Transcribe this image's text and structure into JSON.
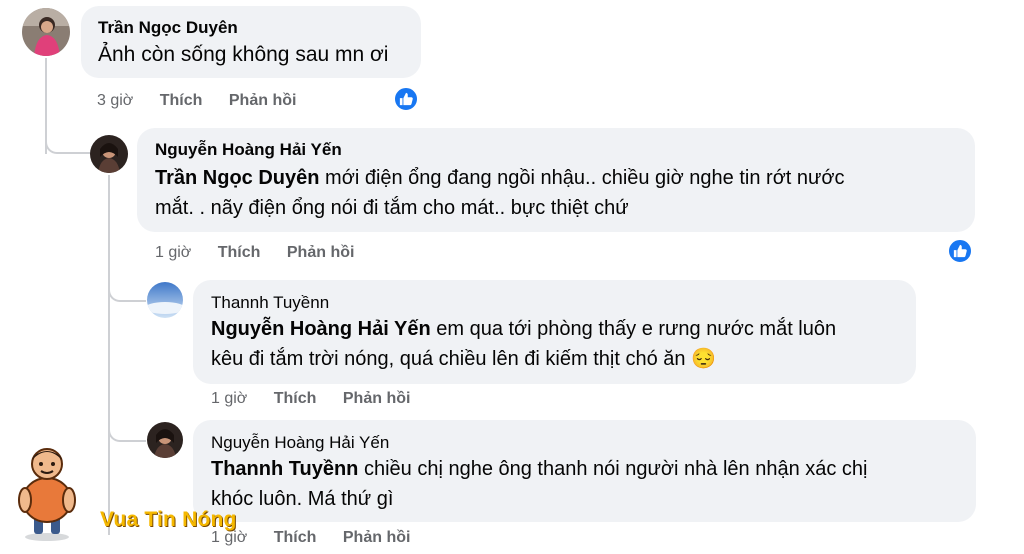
{
  "comments": [
    {
      "author": "Trần Ngọc Duyên",
      "tag": "",
      "text": "Ảnh còn sống không sau mn ơi",
      "time": "3 giờ",
      "like": "Thích",
      "reply": "Phản hồi",
      "liked_icon": "thumbs-up-icon"
    },
    {
      "author": "Nguyễn Hoàng Hải Yến",
      "tag": "Trần Ngọc Duyên",
      "text_line1": " mới điện ổng đang ngồi nhậu.. chiều giờ nghe tin rớt nước",
      "text_line2": "mắt. . nãy điện ổng nói đi tắm cho mát.. bực thiệt chứ",
      "time": "1 giờ",
      "like": "Thích",
      "reply": "Phản hồi",
      "liked_icon": "thumbs-up-icon"
    },
    {
      "author": "Thannh Tuyềnn",
      "tag": "Nguyễn Hoàng Hải Yến",
      "text_line1": " em qua tới phòng thấy e rưng nước mắt luôn",
      "text_line2": "kêu đi tắm trời nóng, quá chiều lên đi kiếm thịt chó ăn 😔",
      "time": "1 giờ",
      "like": "Thích",
      "reply": "Phản hồi"
    },
    {
      "author": "Nguyễn Hoàng Hải Yến",
      "tag": "Thannh Tuyềnn",
      "text_line1": " chiều chị nghe ông thanh nói người nhà lên nhận xác chị",
      "text_line2": "khóc luôn. Má thứ gì",
      "time": "1 giờ",
      "like": "Thích",
      "reply": "Phản hồi"
    }
  ],
  "watermark": {
    "text": "Vua Tin Nóng",
    "color": "#f5b800"
  },
  "colors": {
    "bubble": "#f0f2f5",
    "meta": "#65676b",
    "like_blue": "#1877f2",
    "thread_line": "#ced0d4"
  }
}
